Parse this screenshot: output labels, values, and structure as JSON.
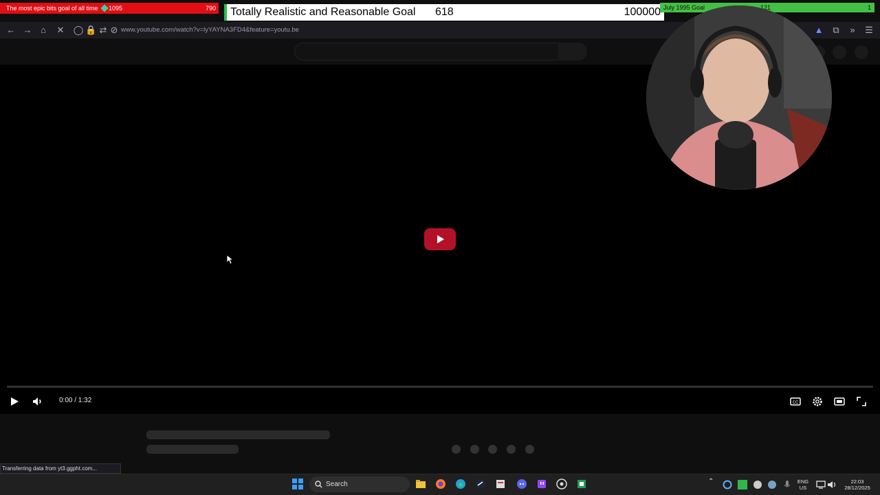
{
  "overlay": {
    "bits_goal": {
      "title": "The most epic bits goal of all time",
      "current": "1095",
      "target": "790"
    },
    "realistic_goal": {
      "title": "Totally Realistic and Reasonable Goal",
      "current": "618",
      "target": "100000"
    },
    "july_goal": {
      "title": "July 1995 Goal",
      "current": "121",
      "target": "1"
    }
  },
  "browser": {
    "url": "www.youtube.com/watch?v=lyYAYNA3FD4&feature=youtu.be"
  },
  "player": {
    "time": "0:00 / 1:32",
    "progress_fraction": 0
  },
  "status_bar": "Transferring data from yt3.ggpht.com...",
  "taskbar": {
    "search_label": "Search",
    "lang": "ENG",
    "region": "US",
    "time": "22:03",
    "date": "28/12/2025"
  },
  "colors": {
    "youtube_red": "#b31128",
    "bits_red": "#e10e14",
    "goal_green": "#43c043"
  }
}
